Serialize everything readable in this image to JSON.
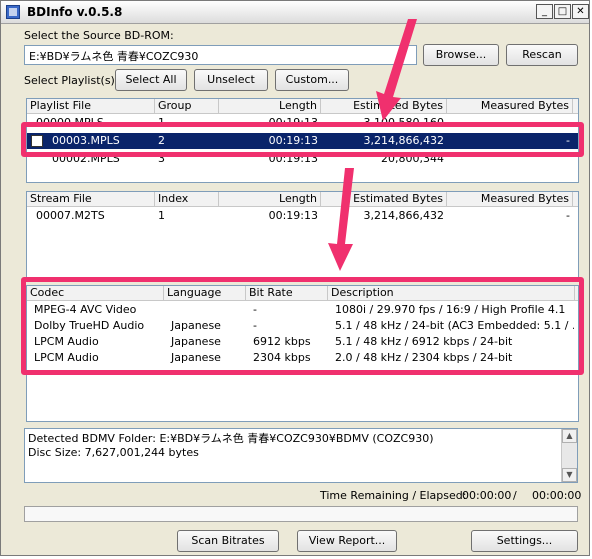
{
  "window": {
    "title": "BDInfo v.0.5.8",
    "controls": {
      "minimize": "_",
      "maximize": "□",
      "close": "✕"
    }
  },
  "source": {
    "label": "Select the Source BD-ROM:",
    "value": "E:¥BD¥ラムネ色 青春¥COZC930",
    "browse": "Browse...",
    "rescan": "Rescan"
  },
  "playlist_controls": {
    "label": "Select Playlist(s):",
    "select_all": "Select All",
    "unselect": "Unselect",
    "custom": "Custom..."
  },
  "playlist_table": {
    "columns": [
      "Playlist File",
      "Group",
      "Length",
      "Estimated Bytes",
      "Measured Bytes"
    ],
    "rows": [
      {
        "file": "00000.MPLS",
        "group": "1",
        "length": "00:19:13",
        "estimated": "3,100,580,160",
        "measured": ""
      },
      {
        "file": "00003.MPLS",
        "group": "2",
        "length": "00:19:13",
        "estimated": "3,214,866,432",
        "measured": "-"
      },
      {
        "file": "00002.MPLS",
        "group": "3",
        "length": "00:19:13",
        "estimated": "20,800,344",
        "measured": ""
      }
    ]
  },
  "stream_table": {
    "columns": [
      "Stream File",
      "Index",
      "Length",
      "Estimated Bytes",
      "Measured Bytes"
    ],
    "rows": [
      {
        "file": "00007.M2TS",
        "index": "1",
        "length": "00:19:13",
        "estimated": "3,214,866,432",
        "measured": "-"
      }
    ]
  },
  "codec_table": {
    "columns": [
      "Codec",
      "Language",
      "Bit Rate",
      "Description"
    ],
    "rows": [
      {
        "codec": "MPEG-4 AVC Video",
        "language": "",
        "bitrate": "-",
        "description": "1080i / 29.970 fps / 16:9 / High Profile 4.1"
      },
      {
        "codec": "Dolby TrueHD Audio",
        "language": "Japanese",
        "bitrate": "-",
        "description": "5.1 / 48 kHz / 24-bit (AC3 Embedded: 5.1 / ..."
      },
      {
        "codec": "LPCM Audio",
        "language": "Japanese",
        "bitrate": "6912 kbps",
        "description": "5.1 / 48 kHz / 6912 kbps / 24-bit"
      },
      {
        "codec": "LPCM Audio",
        "language": "Japanese",
        "bitrate": "2304 kbps",
        "description": "2.0 / 48 kHz / 2304 kbps / 24-bit"
      }
    ]
  },
  "log": {
    "line1": "Detected BDMV Folder: E:¥BD¥ラムネ色 青春¥COZC930¥BDMV (COZC930)",
    "line2": "Disc Size: 7,627,001,244 bytes"
  },
  "status": {
    "label": "Time Remaining / Elapsed:",
    "remaining": "00:00:00",
    "separator": "/",
    "elapsed": "00:00:00",
    "progress_fraction": 0
  },
  "bottom_buttons": {
    "scan": "Scan Bitrates",
    "report": "View Report...",
    "settings": "Settings..."
  },
  "colors": {
    "highlight": "#f0306e",
    "selection": "#0a246a"
  }
}
